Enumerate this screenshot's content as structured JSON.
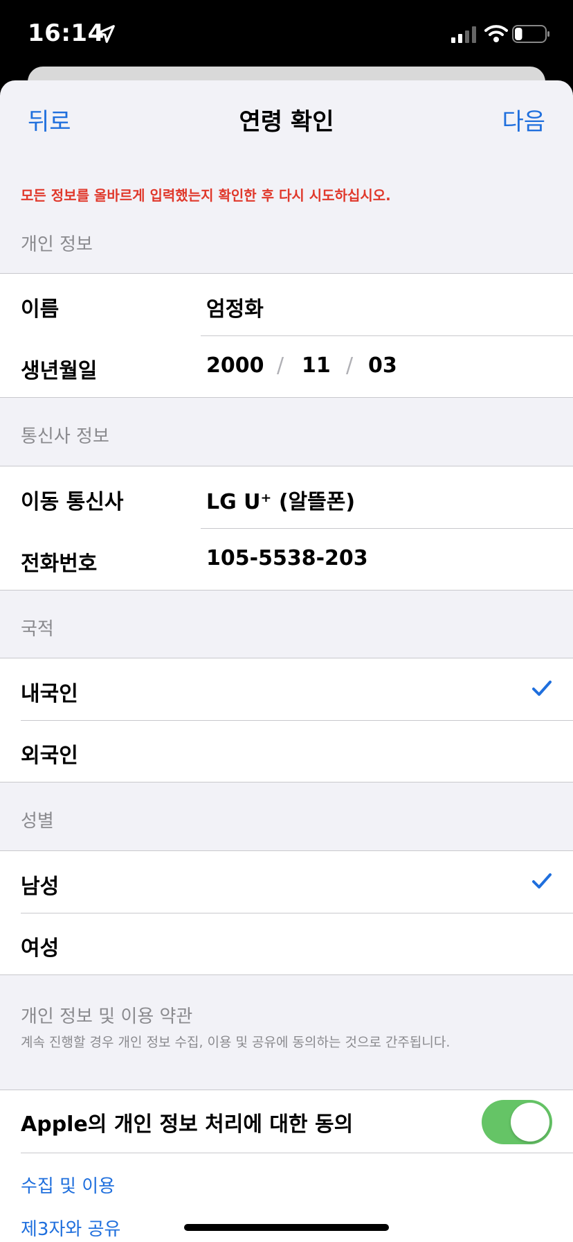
{
  "status_bar": {
    "time": "16:14",
    "battery_level": 0.25
  },
  "nav": {
    "back": "뒤로",
    "title": "연령 확인",
    "next": "다음"
  },
  "error": "모든 정보를 올바르게 입력했는지 확인한 후 다시 시도하십시오.",
  "personal": {
    "header": "개인 정보",
    "name_label": "이름",
    "name_value": "엄정화",
    "birth_label": "생년월일",
    "birth_year": "2000",
    "birth_month": "11",
    "birth_day": "03",
    "separator": "/"
  },
  "carrier": {
    "header": "통신사 정보",
    "carrier_label": "이동 통신사",
    "carrier_value": "LG U⁺ (알뜰폰)",
    "phone_label": "전화번호",
    "phone_value": "105-5538-203"
  },
  "nationality": {
    "header": "국적",
    "options": [
      "내국인",
      "외국인"
    ],
    "selected": "내국인"
  },
  "gender": {
    "header": "성별",
    "options": [
      "남성",
      "여성"
    ],
    "selected": "남성"
  },
  "terms": {
    "title": "개인 정보 및 이용 약관",
    "description": "계속 진행할 경우 개인 정보 수집, 이용 및 공유에 동의하는 것으로 간주됩니다."
  },
  "consent": {
    "label": "Apple의 개인 정보 처리에 대한 동의",
    "enabled": true,
    "links": [
      "수집 및 이용",
      "제3자와 공유"
    ]
  },
  "colors": {
    "accent": "#1f6fdd",
    "error": "#e0382b",
    "toggle_on": "#65c466"
  }
}
